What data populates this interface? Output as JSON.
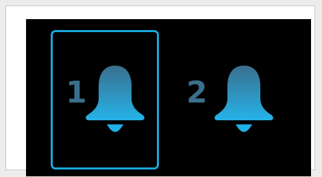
{
  "accent_color": "#1aa9dc",
  "number_color": "#3a6f8c",
  "alarms": [
    {
      "number": "1",
      "icon": "bell-icon",
      "selected": true
    },
    {
      "number": "2",
      "icon": "bell-icon",
      "selected": false
    }
  ]
}
